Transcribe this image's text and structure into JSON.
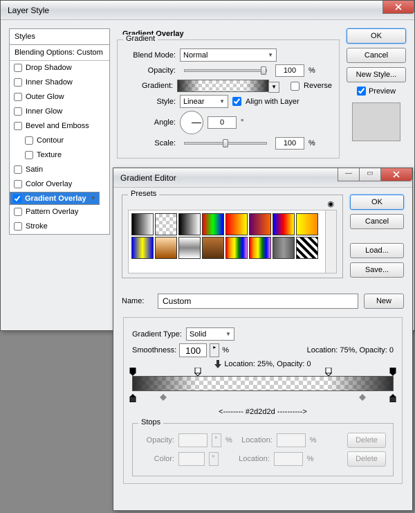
{
  "layerStyle": {
    "title": "Layer Style",
    "stylesHeader": "Styles",
    "blendingOptions": "Blending Options: Custom",
    "items": [
      {
        "label": "Drop Shadow",
        "checked": false
      },
      {
        "label": "Inner Shadow",
        "checked": false
      },
      {
        "label": "Outer Glow",
        "checked": false
      },
      {
        "label": "Inner Glow",
        "checked": false
      },
      {
        "label": "Bevel and Emboss",
        "checked": false
      },
      {
        "label": "Contour",
        "checked": false,
        "indent": true
      },
      {
        "label": "Texture",
        "checked": false,
        "indent": true
      },
      {
        "label": "Satin",
        "checked": false
      },
      {
        "label": "Color Overlay",
        "checked": false
      },
      {
        "label": "Gradient Overlay",
        "checked": true,
        "selected": true
      },
      {
        "label": "Pattern Overlay",
        "checked": false
      },
      {
        "label": "Stroke",
        "checked": false
      }
    ],
    "sectionTitle": "Gradient Overlay",
    "gradientGroup": "Gradient",
    "blendModeLabel": "Blend Mode:",
    "blendModeValue": "Normal",
    "opacityLabel": "Opacity:",
    "opacityValue": "100",
    "pct": "%",
    "gradientLabel": "Gradient:",
    "reverseLabel": "Reverse",
    "styleLabel": "Style:",
    "styleValue": "Linear",
    "alignLabel": "Align with Layer",
    "angleLabel": "Angle:",
    "angleValue": "0",
    "deg": "°",
    "scaleLabel": "Scale:",
    "scaleValue": "100",
    "buttons": {
      "ok": "OK",
      "cancel": "Cancel",
      "newStyle": "New Style...",
      "preview": "Preview"
    }
  },
  "gradientEditor": {
    "title": "Gradient Editor",
    "presets": "Presets",
    "nameLabel": "Name:",
    "nameValue": "Custom",
    "newBtn": "New",
    "gradTypeLabel": "Gradient Type:",
    "gradTypeValue": "Solid",
    "smoothLabel": "Smoothness:",
    "smoothValue": "100",
    "pct": "%",
    "locTopRight": "Location: 75%, Opacity: 0",
    "locTopLeft": "Location: 25%, Opacity: 0",
    "midLabel": "<--------  #2d2d2d  ---------->",
    "stops": {
      "title": "Stops",
      "opacityLabel": "Opacity:",
      "locationLabel": "Location:",
      "colorLabel": "Color:",
      "delete": "Delete",
      "pct": "%"
    },
    "buttons": {
      "ok": "OK",
      "cancel": "Cancel",
      "load": "Load...",
      "save": "Save..."
    }
  },
  "chart_data": {
    "type": "table",
    "title": "Gradient Overlay settings",
    "series": [
      {
        "name": "Opacity",
        "values": [
          100
        ]
      },
      {
        "name": "Angle",
        "values": [
          0
        ]
      },
      {
        "name": "Scale",
        "values": [
          100
        ]
      },
      {
        "name": "Smoothness",
        "values": [
          100
        ]
      }
    ],
    "gradient_stops": {
      "opacity_stops": [
        {
          "location": 0,
          "opacity": 100
        },
        {
          "location": 25,
          "opacity": 0
        },
        {
          "location": 75,
          "opacity": 0
        },
        {
          "location": 100,
          "opacity": 100
        }
      ],
      "color_stops": [
        {
          "location": 0,
          "color": "#2d2d2d"
        },
        {
          "location": 100,
          "color": "#2d2d2d"
        }
      ]
    }
  }
}
